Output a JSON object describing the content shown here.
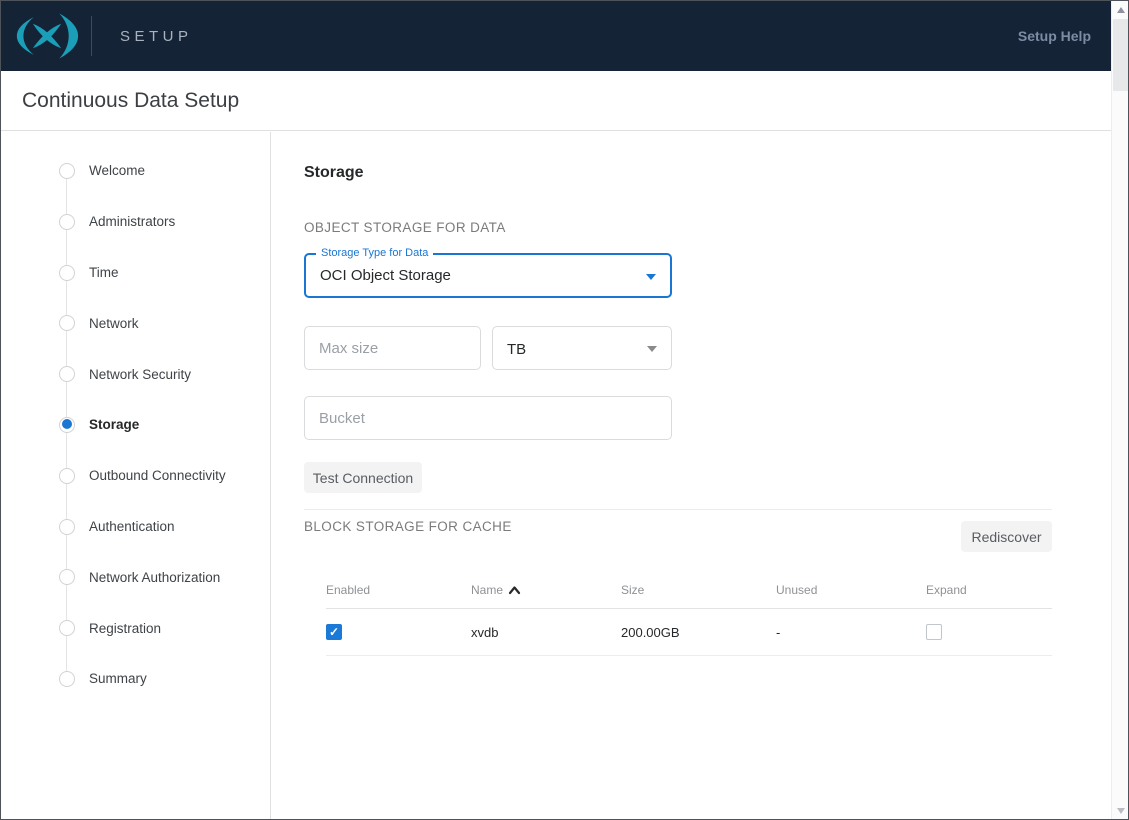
{
  "header": {
    "product": "SETUP",
    "help_label": "Setup Help",
    "bg_color": "#152337",
    "brand_color": "#1b9fb9"
  },
  "page": {
    "title": "Continuous Data Setup"
  },
  "stepper": {
    "active_index": 5,
    "steps": [
      "Welcome",
      "Administrators",
      "Time",
      "Network",
      "Network Security",
      "Storage",
      "Outbound Connectivity",
      "Authentication",
      "Network Authorization",
      "Registration",
      "Summary"
    ]
  },
  "main": {
    "heading": "Storage",
    "object_storage": {
      "section_title": "OBJECT STORAGE FOR DATA",
      "storage_type": {
        "label": "Storage Type for Data",
        "value": "OCI Object Storage"
      },
      "max_size": {
        "placeholder": "Max size",
        "value": ""
      },
      "unit": {
        "value": "TB"
      },
      "bucket": {
        "placeholder": "Bucket",
        "value": ""
      },
      "test_button_label": "Test Connection"
    },
    "block_storage": {
      "section_title": "BLOCK STORAGE FOR CACHE",
      "rediscover_button_label": "Rediscover",
      "table": {
        "columns": [
          "Enabled",
          "Name",
          "Size",
          "Unused",
          "Expand"
        ],
        "sort_column": "Name",
        "sort_direction": "asc",
        "rows": [
          {
            "enabled": true,
            "name": "xvdb",
            "size": "200.00GB",
            "unused": "-",
            "expand": false
          }
        ]
      }
    }
  },
  "colors": {
    "accent_blue": "#1976d2",
    "checkbox_blue": "#1b79d7",
    "header_navy": "#152337",
    "brand_teal": "#1b9fb9"
  }
}
